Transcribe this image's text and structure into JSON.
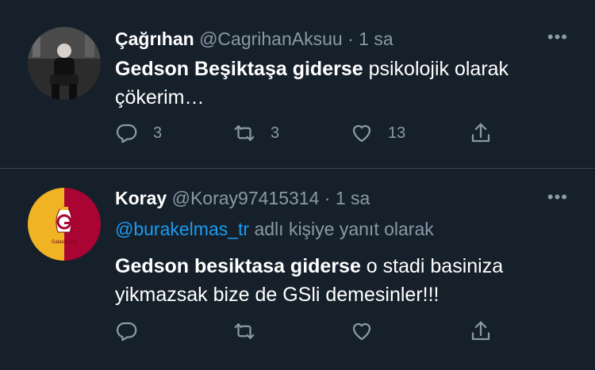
{
  "tweets": [
    {
      "name": "Çağrıhan",
      "handle": "@CagrihanAksuu",
      "separator": "·",
      "time": "1 sa",
      "more": "•••",
      "body_bold": "Gedson Beşiktaşa giderse",
      "body_rest": " psikolojik olarak çökerim…",
      "replies": "3",
      "retweets": "3",
      "likes": "13"
    },
    {
      "name": "Koray",
      "handle": "@Koray97415314",
      "separator": "·",
      "time": "1 sa",
      "more": "•••",
      "reply_mention": "@burakelmas_tr",
      "reply_suffix": " adlı kişiye yanıt olarak",
      "body_bold": "Gedson besiktasa giderse",
      "body_rest": " o stadi basiniza yikmazsak bize de GSli demesinler!!!",
      "avatar_text": "Galatasaray"
    }
  ],
  "colors": {
    "background": "#15202b",
    "divider": "#38444d",
    "secondary_text": "#8b98a5",
    "link": "#1d9bf0",
    "gs_yellow": "#f0b323",
    "gs_red": "#a90432"
  },
  "icons": [
    "reply-icon",
    "retweet-icon",
    "like-icon",
    "share-icon",
    "more-icon"
  ]
}
